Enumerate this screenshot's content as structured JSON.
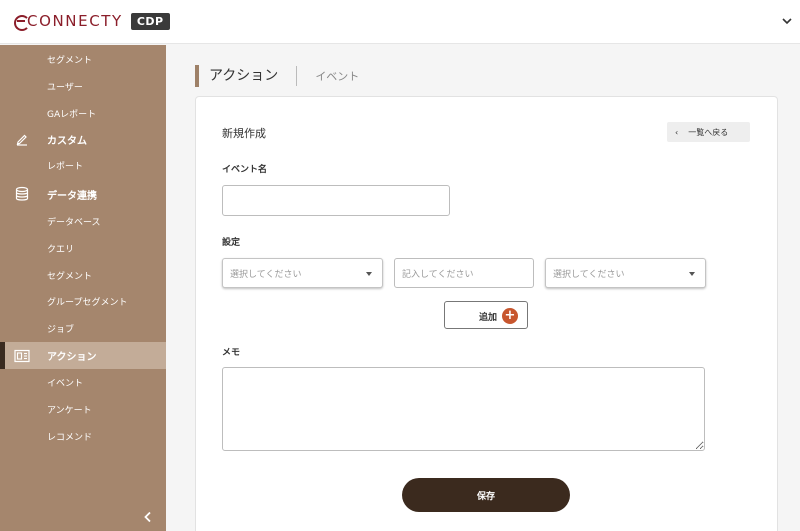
{
  "header": {
    "logo_text": "CONNECTY",
    "logo_badge": "CDP",
    "menu_icon": "chevron-down-icon"
  },
  "sidebar": {
    "items": [
      {
        "label": "セグメント",
        "type": "sub"
      },
      {
        "label": "ユーザー",
        "type": "sub"
      },
      {
        "label": "GAレポート",
        "type": "sub"
      },
      {
        "label": "カスタム",
        "type": "group",
        "icon": "pencil-icon"
      },
      {
        "label": "レポート",
        "type": "sub"
      },
      {
        "label": "データ連携",
        "type": "group",
        "icon": "database-icon"
      },
      {
        "label": "データベース",
        "type": "sub"
      },
      {
        "label": "クエリ",
        "type": "sub"
      },
      {
        "label": "セグメント",
        "type": "sub"
      },
      {
        "label": "グループセグメント",
        "type": "sub"
      },
      {
        "label": "ジョブ",
        "type": "sub"
      },
      {
        "label": "アクション",
        "type": "group",
        "icon": "action-icon",
        "active": true
      },
      {
        "label": "イベント",
        "type": "sub"
      },
      {
        "label": "アンケート",
        "type": "sub"
      },
      {
        "label": "レコメンド",
        "type": "sub"
      }
    ],
    "collapse_icon": "chevron-left-icon"
  },
  "tabs": {
    "active": "アクション",
    "inactive": "イベント"
  },
  "form": {
    "title": "新規作成",
    "back_label": "一覧へ戻る",
    "event_name_label": "イベント名",
    "event_name_value": "",
    "settings_label": "設定",
    "select1_placeholder": "選択してください",
    "input_placeholder": "記入してください",
    "select2_placeholder": "選択してください",
    "add_label": "追加",
    "memo_label": "メモ",
    "memo_value": "",
    "save_label": "保存"
  },
  "colors": {
    "sidebar_bg": "#a5866d",
    "sidebar_active": "#c3ac98",
    "brand": "#8b1e2a",
    "save_button": "#3b2a1e",
    "add_icon": "#c7562e"
  }
}
